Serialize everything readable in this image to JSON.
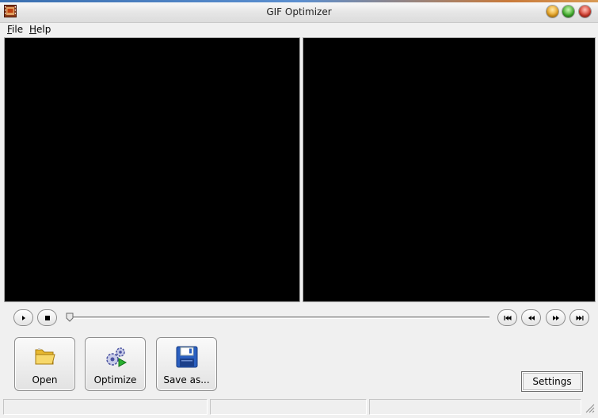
{
  "window": {
    "title": "GIF Optimizer",
    "icon": "film-strip-icon"
  },
  "menu": {
    "file": {
      "mnemonic": "F",
      "rest": "ile"
    },
    "help": {
      "mnemonic": "H",
      "rest": "elp"
    }
  },
  "playback": {
    "play_icon": "play-icon",
    "stop_icon": "stop-icon",
    "first_icon": "skip-first-icon",
    "prev_icon": "step-back-icon",
    "next_icon": "step-forward-icon",
    "last_icon": "skip-last-icon",
    "position": 0
  },
  "actions": {
    "open_label": "Open",
    "optimize_label": "Optimize",
    "save_label": "Save as...",
    "settings_label": "Settings"
  },
  "colors": {
    "pane_background": "#000000",
    "window_background": "#f0f0f0"
  }
}
